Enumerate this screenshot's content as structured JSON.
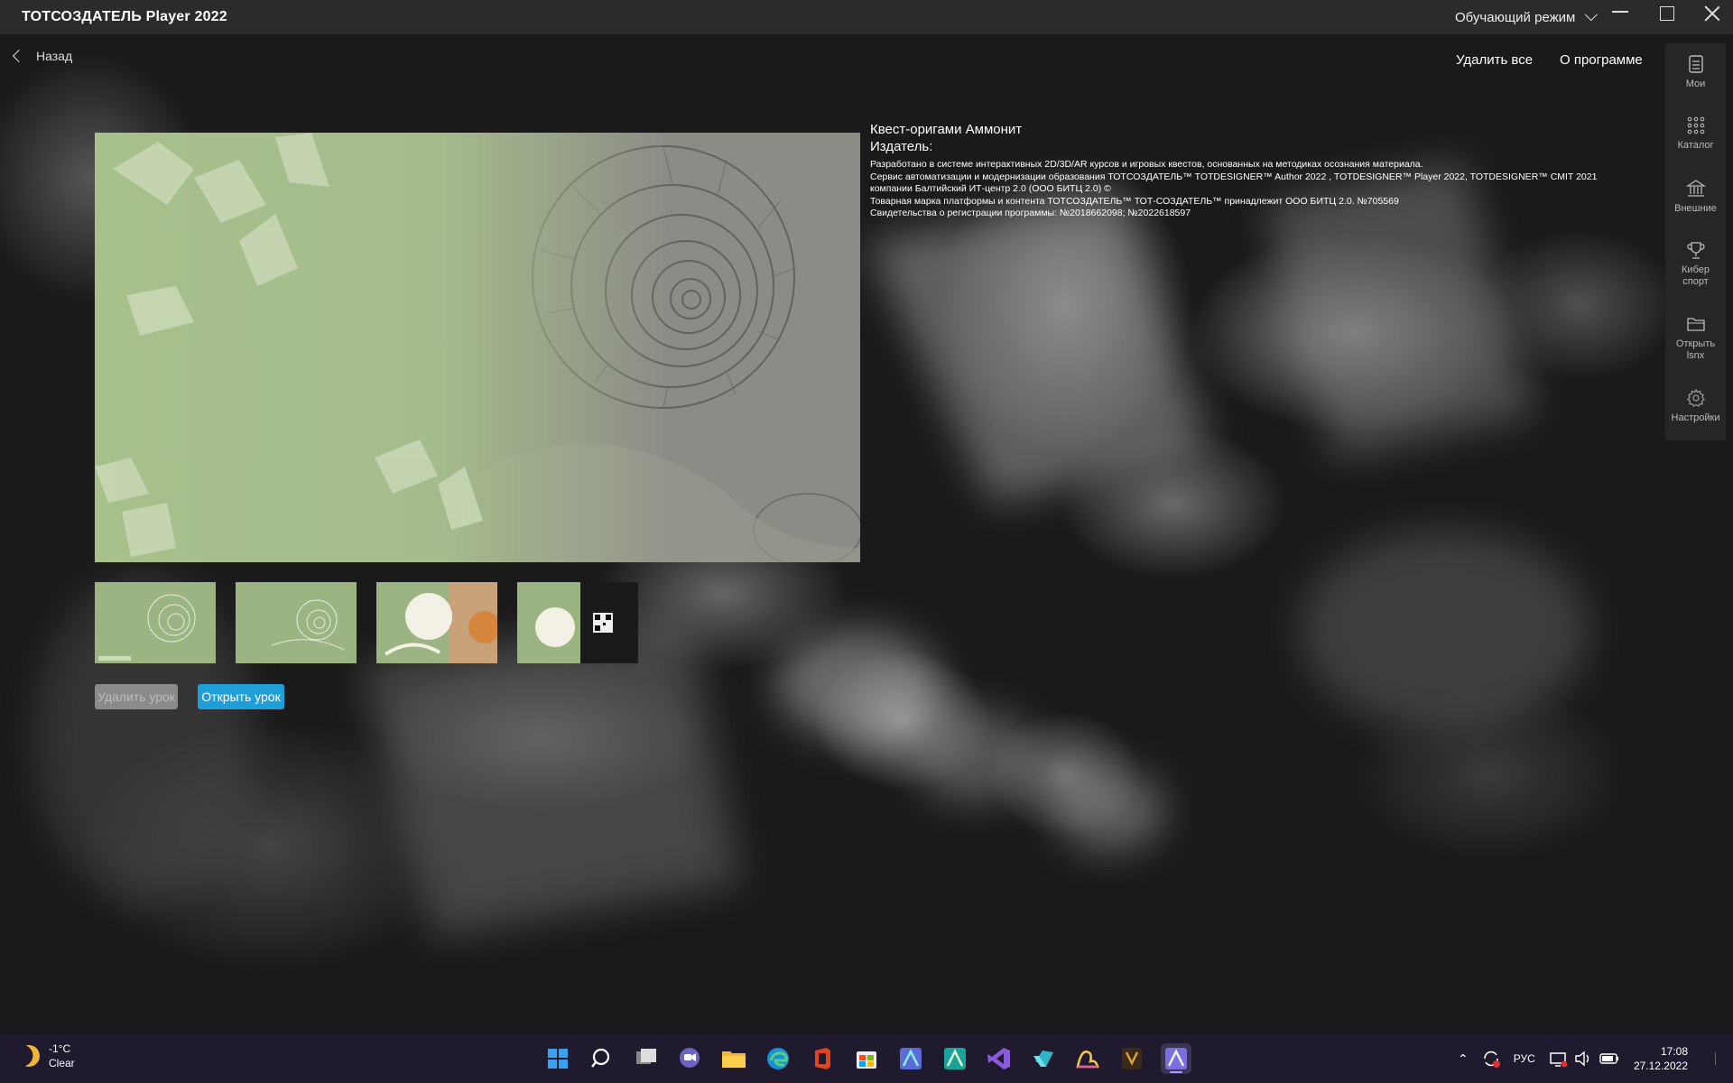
{
  "window": {
    "title": "ТОТСОЗДАТЕЛЬ Player 2022",
    "mode_label": "Обучающий режим"
  },
  "nav": {
    "back_label": "Назад",
    "delete_all_label": "Удалить все",
    "about_label": "О программе"
  },
  "rail": {
    "items": [
      {
        "label": "Мои",
        "icon": "list-icon"
      },
      {
        "label": "Каталог",
        "icon": "grid-icon"
      },
      {
        "label": "Внешние",
        "icon": "bank-icon"
      },
      {
        "label": "Кибер спорт",
        "icon": "trophy-icon"
      },
      {
        "label": "Открыть lsnx",
        "icon": "folder-icon"
      },
      {
        "label": "Настройки",
        "icon": "gear-icon"
      }
    ]
  },
  "lesson": {
    "title": "Квест-оригами Аммонит",
    "publisher_label": "Издатель:",
    "lines": [
      "Разработано в системе интерактивных 2D/3D/AR курсов и игровых квестов, основанных на методиках осознания материала.",
      "Сервис автоматизации и модернизации образования ТОТСОЗДАТЕЛЬ™ TOTDESIGNER™ Author 2022 , TOTDESIGNER™ Player 2022, TOTDESIGNER™ CMIT 2021",
      "компании Балтийский ИТ-центр 2.0 (ООО БИТЦ 2.0) ©",
      "Товарная марка платформы и контента ТОТСОЗДАТЕЛЬ™ ТОТ-СОЗДАТЕЛЬ™ принадлежит ООО БИТЦ 2.0. №705569",
      "Свидетельства о регистрации программы: №2018662098; №2022618597"
    ],
    "delete_button": "Удалить урок",
    "open_button": "Открыть урок"
  },
  "taskbar": {
    "weather_temp": "-1°C",
    "weather_desc": "Clear",
    "lang": "РУС",
    "time": "17:08",
    "date": "27.12.2022",
    "apps": [
      "start-icon",
      "search-icon",
      "task-view-icon",
      "chat-icon",
      "file-explorer-icon",
      "edge-icon",
      "office-icon",
      "store-icon",
      "app-icon-1",
      "app-icon-2",
      "visual-studio-icon",
      "app-icon-3",
      "app-icon-4",
      "app-icon-5",
      "totdesigner-player-icon"
    ]
  },
  "colors": {
    "titlebar": "#2b2b2b",
    "accent_button": "#1e9fd8",
    "preview_green": "#a7bf8b",
    "taskbar": "#1f1a2e"
  }
}
